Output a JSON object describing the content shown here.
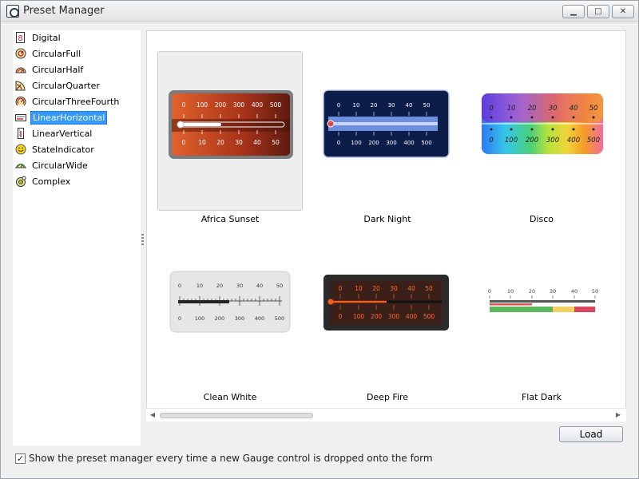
{
  "window": {
    "title": "Preset Manager",
    "minimize_glyph": "▁",
    "maximize_glyph": "□",
    "close_glyph": "✕"
  },
  "sidebar": {
    "items": [
      {
        "label": "Digital",
        "icon": "digital-gauge-icon",
        "selected": false
      },
      {
        "label": "CircularFull",
        "icon": "circular-full-gauge-icon",
        "selected": false
      },
      {
        "label": "CircularHalf",
        "icon": "circular-half-gauge-icon",
        "selected": false
      },
      {
        "label": "CircularQuarter",
        "icon": "circular-quarter-gauge-icon",
        "selected": false
      },
      {
        "label": "CircularThreeFourth",
        "icon": "circular-three-fourth-gauge-icon",
        "selected": false
      },
      {
        "label": "LinearHorizontal",
        "icon": "linear-horizontal-gauge-icon",
        "selected": true
      },
      {
        "label": "LinearVertical",
        "icon": "linear-vertical-gauge-icon",
        "selected": false
      },
      {
        "label": "StateIndicator",
        "icon": "state-indicator-icon",
        "selected": false
      },
      {
        "label": "CircularWide",
        "icon": "circular-wide-gauge-icon",
        "selected": false
      },
      {
        "label": "Complex",
        "icon": "complex-gauge-icon",
        "selected": false
      }
    ]
  },
  "presets": [
    {
      "name": "Africa Sunset",
      "selected": true,
      "top_scale": [
        "0",
        "100",
        "200",
        "300",
        "400",
        "500"
      ],
      "bottom_scale": [
        "0",
        "10",
        "20",
        "30",
        "40",
        "50"
      ]
    },
    {
      "name": "Dark Night",
      "selected": false,
      "top_scale": [
        "0",
        "10",
        "20",
        "30",
        "40",
        "50"
      ],
      "bottom_scale": [
        "0",
        "100",
        "200",
        "300",
        "400",
        "500"
      ]
    },
    {
      "name": "Disco",
      "selected": false,
      "top_scale": [
        "0",
        "10",
        "20",
        "30",
        "40",
        "50"
      ],
      "bottom_scale": [
        "0",
        "100",
        "200",
        "300",
        "400",
        "500"
      ]
    },
    {
      "name": "Clean White",
      "selected": false,
      "top_scale": [
        "0",
        "10",
        "20",
        "30",
        "40",
        "50"
      ],
      "bottom_scale": [
        "0",
        "100",
        "200",
        "300",
        "400",
        "500"
      ]
    },
    {
      "name": "Deep Fire",
      "selected": false,
      "top_scale": [
        "0",
        "10",
        "20",
        "30",
        "40",
        "50"
      ],
      "bottom_scale": [
        "0",
        "100",
        "200",
        "300",
        "400",
        "500"
      ]
    },
    {
      "name": "Flat Dark",
      "selected": false,
      "top_scale": [
        "0",
        "10",
        "20",
        "30",
        "40",
        "50"
      ],
      "bottom_scale": []
    }
  ],
  "footer": {
    "load_label": "Load",
    "checkbox_checked": true,
    "checkbox_glyph": "✓",
    "checkbox_label": "Show the preset manager every time a new Gauge control is dropped onto the form"
  },
  "scrollbar": {
    "left_arrow": "◀",
    "right_arrow": "▶"
  },
  "colors": {
    "selection": "#3399ff",
    "window_bg": "#f0f0f0"
  }
}
